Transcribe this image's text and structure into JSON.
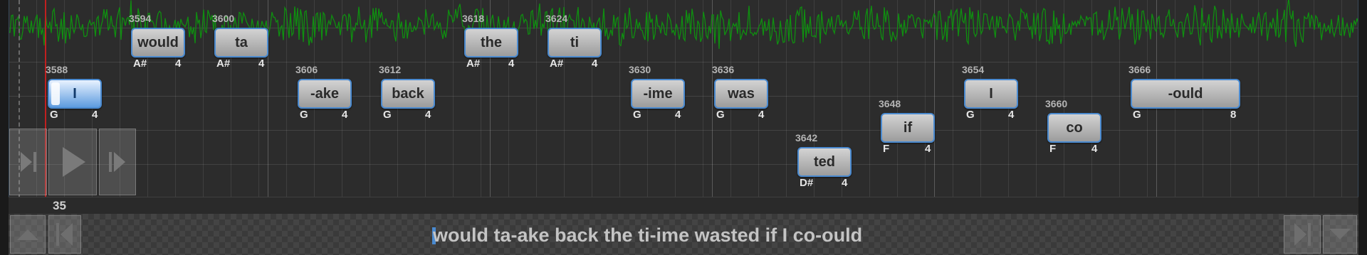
{
  "line_number": "35",
  "lyrics": "would ta-ake back the ti-ime wasted if I co-ould",
  "colors": {
    "waveform": "#0f8f10",
    "note_border": "#4a8ad0",
    "playhead": "#c02020",
    "background": "#2c2c2c"
  },
  "notes": [
    {
      "beat": "3588",
      "text": "I",
      "pitch": "G",
      "length": "4",
      "active": true
    },
    {
      "beat": "3594",
      "text": "would",
      "pitch": "A#",
      "length": "4"
    },
    {
      "beat": "3600",
      "text": "ta",
      "pitch": "A#",
      "length": "4"
    },
    {
      "beat": "3606",
      "text": "-ake",
      "pitch": "G",
      "length": "4"
    },
    {
      "beat": "3612",
      "text": "back",
      "pitch": "G",
      "length": "4"
    },
    {
      "beat": "3618",
      "text": "the",
      "pitch": "A#",
      "length": "4"
    },
    {
      "beat": "3624",
      "text": "ti",
      "pitch": "A#",
      "length": "4"
    },
    {
      "beat": "3630",
      "text": "-ime",
      "pitch": "G",
      "length": "4"
    },
    {
      "beat": "3636",
      "text": "was",
      "pitch": "G",
      "length": "4"
    },
    {
      "beat": "3642",
      "text": "ted",
      "pitch": "D#",
      "length": "4"
    },
    {
      "beat": "3648",
      "text": "if",
      "pitch": "F",
      "length": "4"
    },
    {
      "beat": "3654",
      "text": "I",
      "pitch": "G",
      "length": "4"
    },
    {
      "beat": "3660",
      "text": "co",
      "pitch": "F",
      "length": "4"
    },
    {
      "beat": "3666",
      "text": "-ould",
      "pitch": "G",
      "length": "8"
    }
  ],
  "controls": {
    "skip_to_start": "skip-to-start-icon",
    "play": "play-icon",
    "play_note": "play-note-icon",
    "scroll_up": "arrow-up-icon",
    "prev_line": "previous-line-icon",
    "next_line": "next-line-icon",
    "scroll_down": "arrow-down-icon"
  }
}
